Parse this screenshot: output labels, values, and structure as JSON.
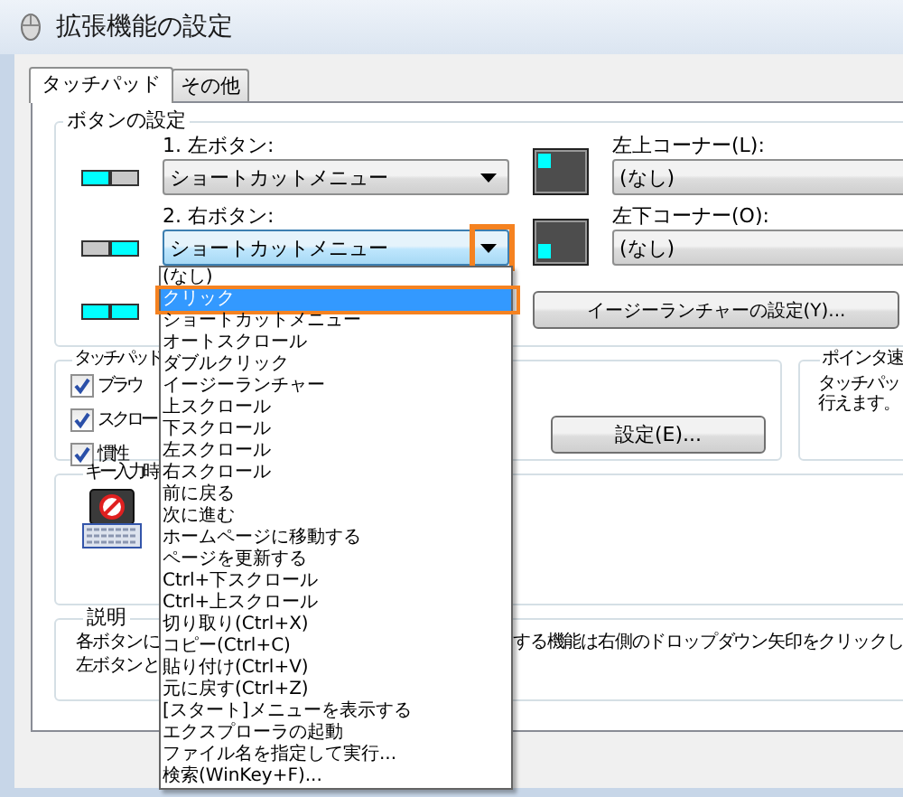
{
  "window": {
    "title": "拡張機能の設定"
  },
  "tabs": [
    {
      "label": "タッチパッド",
      "selected": true
    },
    {
      "label": "その他",
      "selected": false
    }
  ],
  "button_settings": {
    "title": "ボタンの設定",
    "rows": [
      {
        "label": "1. 左ボタン:",
        "value": "ショートカットメニュー",
        "left_lit": true,
        "right_lit": false,
        "focused": false,
        "arrow_highlighted": false
      },
      {
        "label": "2. 右ボタン:",
        "value": "ショートカットメニュー",
        "left_lit": false,
        "right_lit": true,
        "focused": true,
        "arrow_highlighted": true
      },
      {
        "left_lit": true,
        "right_lit": true
      }
    ],
    "corners": [
      {
        "label": "左上コーナー(L):",
        "value": "(なし)",
        "kind": "top"
      },
      {
        "label": "左下コーナー(O):",
        "value": "(なし)",
        "kind": "bottom"
      }
    ],
    "launcher_button": "イージーランチャーの設定(Y)..."
  },
  "touchpad_group": {
    "title": "タッチパッド",
    "checkboxes": [
      {
        "label": "ブラウ",
        "checked": true
      },
      {
        "label": "スクロー",
        "checked": true
      },
      {
        "label": "慣性",
        "checked": true
      }
    ],
    "button": "設定(E)..."
  },
  "pointer_speed": {
    "title": "ポインタ速",
    "lines": [
      "タッチパッ",
      "行えます。"
    ]
  },
  "key_input": {
    "title": "キー入力時"
  },
  "description": {
    "title": "説明",
    "lines": [
      {
        "left": "各ボタンに",
        "right": "する機能は右側のドロップダウン矢印をクリックし"
      },
      {
        "left": "左ボタンと"
      }
    ]
  },
  "dropdown": {
    "items": [
      {
        "label": "(なし)",
        "selected": false,
        "highlighted": false
      },
      {
        "label": "クリック",
        "selected": true,
        "highlighted": true
      },
      {
        "label": "ショートカットメニュー",
        "selected": false,
        "highlighted": false
      },
      {
        "label": "オートスクロール",
        "selected": false,
        "highlighted": false
      },
      {
        "label": "ダブルクリック",
        "selected": false,
        "highlighted": false
      },
      {
        "label": "イージーランチャー",
        "selected": false,
        "highlighted": false
      },
      {
        "label": "上スクロール",
        "selected": false,
        "highlighted": false
      },
      {
        "label": "下スクロール",
        "selected": false,
        "highlighted": false
      },
      {
        "label": "左スクロール",
        "selected": false,
        "highlighted": false
      },
      {
        "label": "右スクロール",
        "selected": false,
        "highlighted": false
      },
      {
        "label": "前に戻る",
        "selected": false,
        "highlighted": false
      },
      {
        "label": "次に進む",
        "selected": false,
        "highlighted": false
      },
      {
        "label": "ホームページに移動する",
        "selected": false,
        "highlighted": false
      },
      {
        "label": "ページを更新する",
        "selected": false,
        "highlighted": false
      },
      {
        "label": "Ctrl+下スクロール",
        "selected": false,
        "highlighted": false
      },
      {
        "label": "Ctrl+上スクロール",
        "selected": false,
        "highlighted": false
      },
      {
        "label": "切り取り(Ctrl+X)",
        "selected": false,
        "highlighted": false
      },
      {
        "label": "コピー(Ctrl+C)",
        "selected": false,
        "highlighted": false
      },
      {
        "label": "貼り付け(Ctrl+V)",
        "selected": false,
        "highlighted": false
      },
      {
        "label": "元に戻す(Ctrl+Z)",
        "selected": false,
        "highlighted": false
      },
      {
        "label": "[スタート]メニューを表示する",
        "selected": false,
        "highlighted": false
      },
      {
        "label": "エクスプローラの起動",
        "selected": false,
        "highlighted": false
      },
      {
        "label": "ファイル名を指定して実行...",
        "selected": false,
        "highlighted": false
      },
      {
        "label": "検索(WinKey+F)...",
        "selected": false,
        "highlighted": false
      }
    ]
  }
}
